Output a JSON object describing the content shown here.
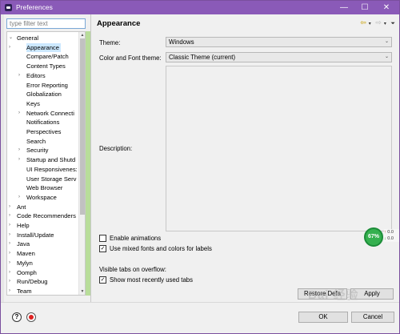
{
  "window": {
    "title": "Preferences",
    "minimize": "—",
    "maximize": "☐",
    "close": "✕"
  },
  "filter": {
    "placeholder": "type filter text"
  },
  "tree": {
    "items": [
      {
        "label": "General",
        "arrow": "⌄",
        "level": 0,
        "expanded": true
      },
      {
        "label": "Appearance",
        "arrow": "›",
        "level": 1,
        "selected": true
      },
      {
        "label": "Compare/Patch",
        "arrow": "",
        "level": 1
      },
      {
        "label": "Content Types",
        "arrow": "",
        "level": 1
      },
      {
        "label": "Editors",
        "arrow": "›",
        "level": 1
      },
      {
        "label": "Error Reporting",
        "arrow": "",
        "level": 1
      },
      {
        "label": "Globalization",
        "arrow": "",
        "level": 1
      },
      {
        "label": "Keys",
        "arrow": "",
        "level": 1
      },
      {
        "label": "Network Connecti",
        "arrow": "›",
        "level": 1
      },
      {
        "label": "Notifications",
        "arrow": "",
        "level": 1
      },
      {
        "label": "Perspectives",
        "arrow": "",
        "level": 1
      },
      {
        "label": "Search",
        "arrow": "",
        "level": 1
      },
      {
        "label": "Security",
        "arrow": "›",
        "level": 1
      },
      {
        "label": "Startup and Shutd",
        "arrow": "›",
        "level": 1
      },
      {
        "label": "UI Responsivenes:",
        "arrow": "",
        "level": 1
      },
      {
        "label": "User Storage Serv",
        "arrow": "",
        "level": 1
      },
      {
        "label": "Web Browser",
        "arrow": "",
        "level": 1
      },
      {
        "label": "Workspace",
        "arrow": "›",
        "level": 1
      },
      {
        "label": "Ant",
        "arrow": "›",
        "level": 0
      },
      {
        "label": "Code Recommenders",
        "arrow": "›",
        "level": 0
      },
      {
        "label": "Help",
        "arrow": "›",
        "level": 0
      },
      {
        "label": "Install/Update",
        "arrow": "›",
        "level": 0
      },
      {
        "label": "Java",
        "arrow": "›",
        "level": 0
      },
      {
        "label": "Maven",
        "arrow": "›",
        "level": 0
      },
      {
        "label": "Mylyn",
        "arrow": "›",
        "level": 0
      },
      {
        "label": "Oomph",
        "arrow": "›",
        "level": 0
      },
      {
        "label": "Run/Debug",
        "arrow": "›",
        "level": 0
      },
      {
        "label": "Team",
        "arrow": "›",
        "level": 0
      }
    ]
  },
  "page": {
    "title": "Appearance",
    "nav": {
      "back": "⇦",
      "back_menu": "▾",
      "forward": "⇨",
      "forward_menu": "▾",
      "menu": "⏷"
    },
    "theme_label": "Theme:",
    "theme_value": "Windows",
    "color_font_label": "Color and Font theme:",
    "color_font_value": "Classic Theme (current)",
    "description_label": "Description:",
    "enable_animations_label": "Enable animations",
    "enable_animations_checked": false,
    "mixed_fonts_label": "Use mixed fonts and colors for labels",
    "mixed_fonts_checked": true,
    "visible_tabs_label": "Visible tabs on overflow:",
    "show_recent_tabs_label": "Show most recently used tabs",
    "show_recent_tabs_checked": true,
    "restore_defaults": "Restore Defa",
    "apply": "Apply"
  },
  "footer": {
    "ok": "OK",
    "cancel": "Cancel",
    "help_icon_glyph": "?"
  },
  "overlay": {
    "gauge_percent": "67%",
    "up_speed": "0.0",
    "down_speed": "0.0",
    "watermark": "Bai 经验"
  }
}
